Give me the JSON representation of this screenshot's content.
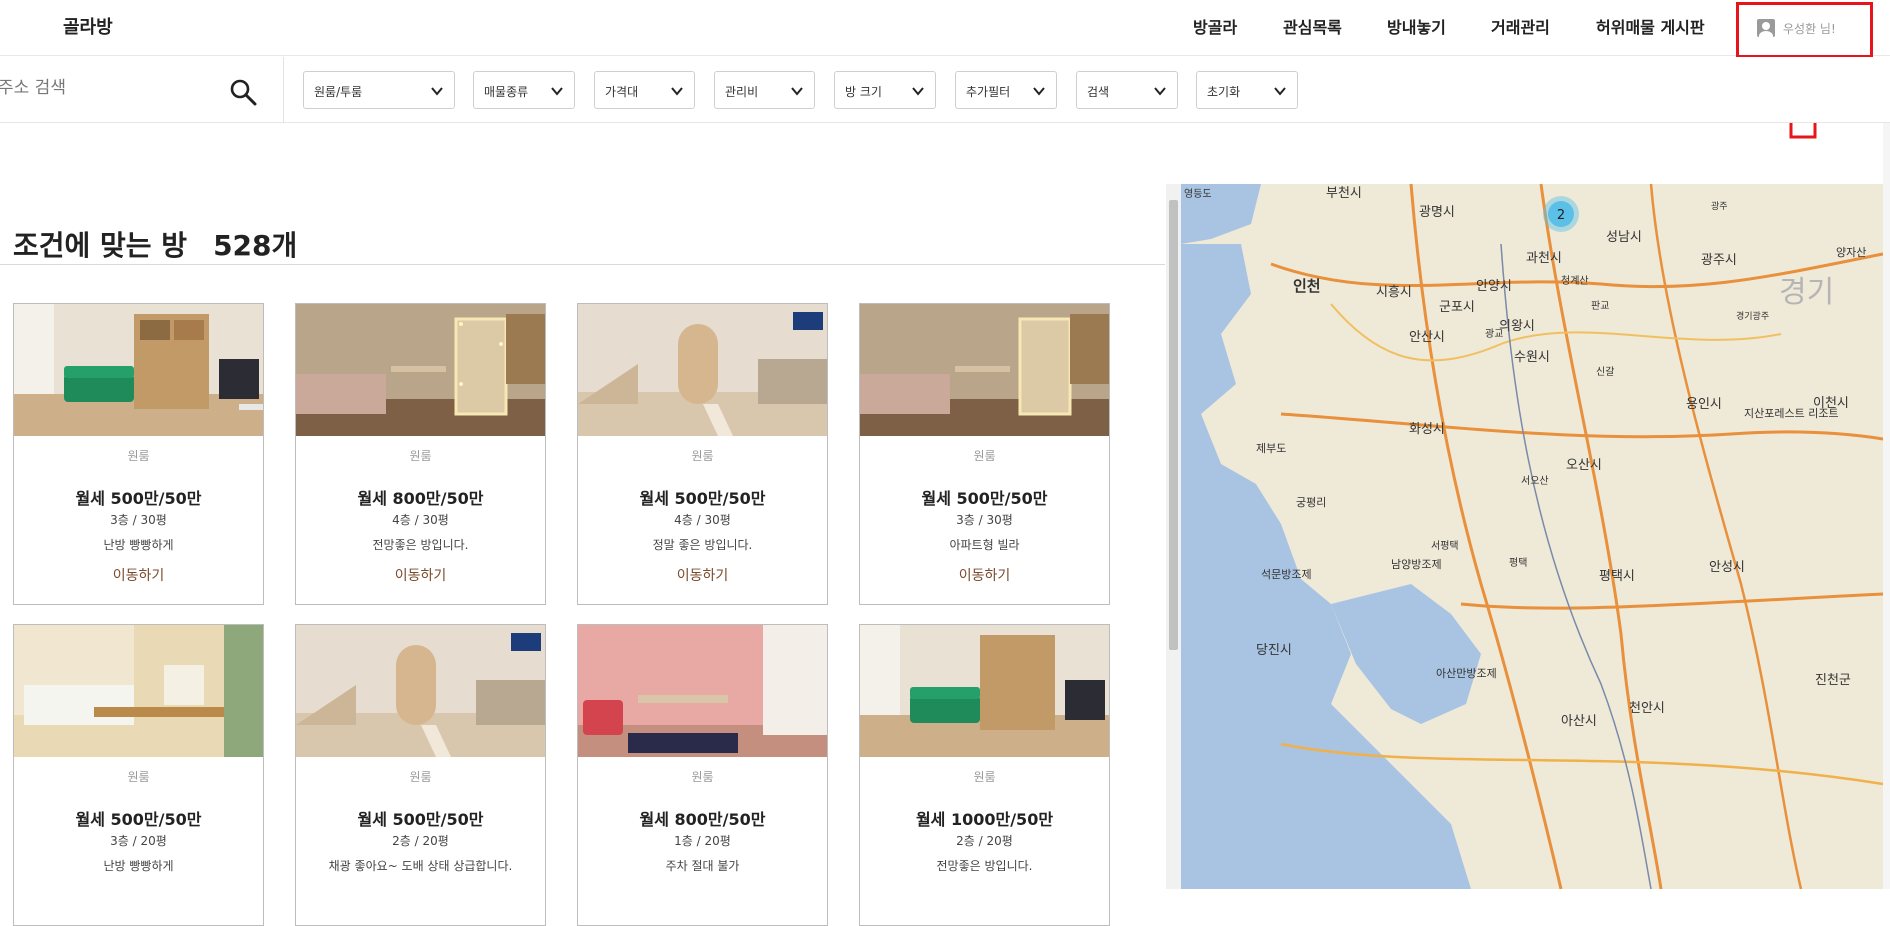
{
  "header": {
    "logo": "골라방",
    "nav": [
      "방골라",
      "관심목록",
      "방내놓기",
      "거래관리",
      "허위매물 게시판"
    ],
    "user": "우성환 님!"
  },
  "search": {
    "placeholder": "주소 검색"
  },
  "filters": [
    "원룸/투룸",
    "매물종류",
    "가격대",
    "관리비",
    "방 크기",
    "추가필터",
    "검색",
    "초기화"
  ],
  "listing": {
    "title": "조건에 맞는 방",
    "count": "528개",
    "cards": [
      {
        "type": "원룸",
        "price": "월세 500만/50만",
        "floor": "3층 / 30평",
        "desc": "난방 빵빵하게",
        "link": "이동하기"
      },
      {
        "type": "원룸",
        "price": "월세 800만/50만",
        "floor": "4층 / 30평",
        "desc": "전망좋은 방입니다.",
        "link": "이동하기"
      },
      {
        "type": "원룸",
        "price": "월세 500만/50만",
        "floor": "4층 / 30평",
        "desc": "정말 좋은 방입니다.",
        "link": "이동하기"
      },
      {
        "type": "원룸",
        "price": "월세 500만/50만",
        "floor": "3층 / 30평",
        "desc": "아파트형 빌라",
        "link": "이동하기"
      },
      {
        "type": "원룸",
        "price": "월세 500만/50만",
        "floor": "3층 / 20평",
        "desc": "난방 빵빵하게",
        "link": "이동하기"
      },
      {
        "type": "원룸",
        "price": "월세 500만/50만",
        "floor": "2층 / 20평",
        "desc": "채광 좋아요~ 도배 상태 상급합니다.",
        "link": "이동하기"
      },
      {
        "type": "원룸",
        "price": "월세 800만/50만",
        "floor": "1층 / 20평",
        "desc": "주차 절대 불가",
        "link": "이동하기"
      },
      {
        "type": "원룸",
        "price": "월세 1000만/50만",
        "floor": "2층 / 20평",
        "desc": "전망좋은 방입니다.",
        "link": "이동하기"
      }
    ]
  },
  "map": {
    "cluster_count": "2",
    "cities": [
      "부천시",
      "광명시",
      "성남시",
      "인천",
      "과천시",
      "광주시",
      "시흥시",
      "안양시",
      "군포시",
      "의왕시",
      "안산시",
      "수원시",
      "이천시",
      "용인시",
      "화성시",
      "오산시",
      "제부도",
      "궁평리",
      "남양방조제",
      "서평택",
      "평택",
      "평택시",
      "안성시",
      "석문방조제",
      "당진시",
      "아산만방조제",
      "천안시",
      "아산시",
      "진천군",
      "지산포레스트 리조트",
      "경기",
      "양자산",
      "청계산",
      "판교",
      "신갈",
      "서오산",
      "광교",
      "영등도",
      "경기광주",
      "광주"
    ]
  },
  "colors": {
    "annotation": "#e8141c",
    "link": "#7a4b2c",
    "cluster": "#5bc0e8"
  }
}
